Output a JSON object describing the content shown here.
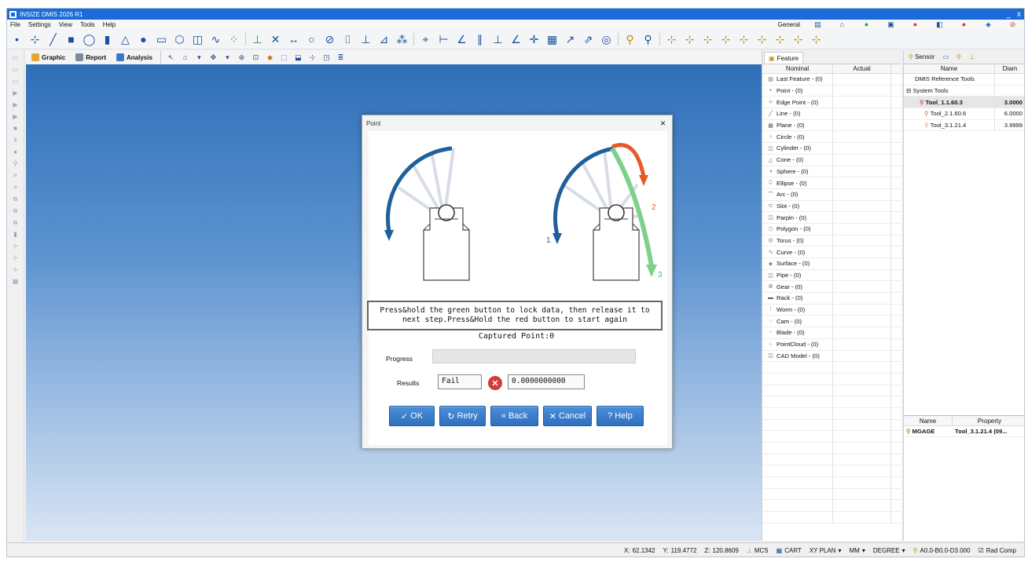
{
  "app": {
    "title": "INSIZE DMIS 2026 R1",
    "win_min": "_",
    "win_close": "x"
  },
  "menu": {
    "items": [
      "File",
      "Settings",
      "View",
      "Tools",
      "Help"
    ],
    "mode": "General"
  },
  "tabs": {
    "graphic": "Graphic",
    "report": "Report",
    "analysis": "Analysis"
  },
  "feature_panel": {
    "tab": "Feature",
    "col_nominal": "Nominal",
    "col_actual": "Actual",
    "items": [
      "Last Feature - (0)",
      "Point - (0)",
      "Edge Point - (0)",
      "Line - (0)",
      "Plane - (0)",
      "Circle - (0)",
      "Cylinder - (0)",
      "Cone - (0)",
      "Sphere - (0)",
      "Ellipse - (0)",
      "Arc - (0)",
      "Slot - (0)",
      "Parpln - (0)",
      "Polygon - (0)",
      "Torus - (0)",
      "Curve - (0)",
      "Surface - (0)",
      "Pipe - (0)",
      "Gear - (0)",
      "Rack - (0)",
      "Worm - (0)",
      "Cam - (0)",
      "Blade - (0)",
      "PointCloud - (0)",
      "CAD Model - (0)"
    ]
  },
  "sensor_panel": {
    "tab_sensor": "Sensor",
    "col_name": "Name",
    "col_diam": "Diam",
    "ref_tools": "DMIS Reference Tools",
    "system_tools": "System Tools",
    "tools": [
      {
        "name": "Tool_1.1.60.3",
        "diam": "3.0000"
      },
      {
        "name": "Tool_2.1.60.6",
        "diam": "6.0000"
      },
      {
        "name": "Tool_3.1.21.4",
        "diam": "3.9999"
      }
    ],
    "prop_name": "Name",
    "prop_property": "Property",
    "prop_row_name": "MGAGE",
    "prop_row_value": "Tool_3.1.21.4 (09..."
  },
  "dialog": {
    "title": "Point",
    "close": "×",
    "instruction": "Press&hold the green button to lock data, then release it to next step.Press&Hold the red button to start again",
    "captured": "Captured Point:0",
    "progress_label": "Progress",
    "progress": 0,
    "results_label": "Results",
    "result_status": "Fail",
    "result_value": "0.0000000000",
    "arrow_labels": {
      "one": "1",
      "two": "2",
      "three": "3"
    },
    "buttons": {
      "ok": "OK",
      "retry": "Retry",
      "back": "Back",
      "cancel": "Cancel",
      "help": "Help"
    }
  },
  "status": {
    "x_label": "X:",
    "x": "62.1342",
    "y_label": "Y:",
    "y": "119.4772",
    "z_label": "Z:",
    "z": "120.8609",
    "mcs": "MCS",
    "cart": "CART",
    "plane": "XY PLAN",
    "units": "MM",
    "angle": "DEGREE",
    "tip": "A0.0-B0.0-D3.000",
    "radcomp": "Rad Comp"
  },
  "colors": {
    "title_blue": "#1b6bd8",
    "arc_blue": "#1f5f9a",
    "arc_red": "#e55a25",
    "arc_green": "#7fd18a",
    "fail_red": "#d23b3b"
  }
}
